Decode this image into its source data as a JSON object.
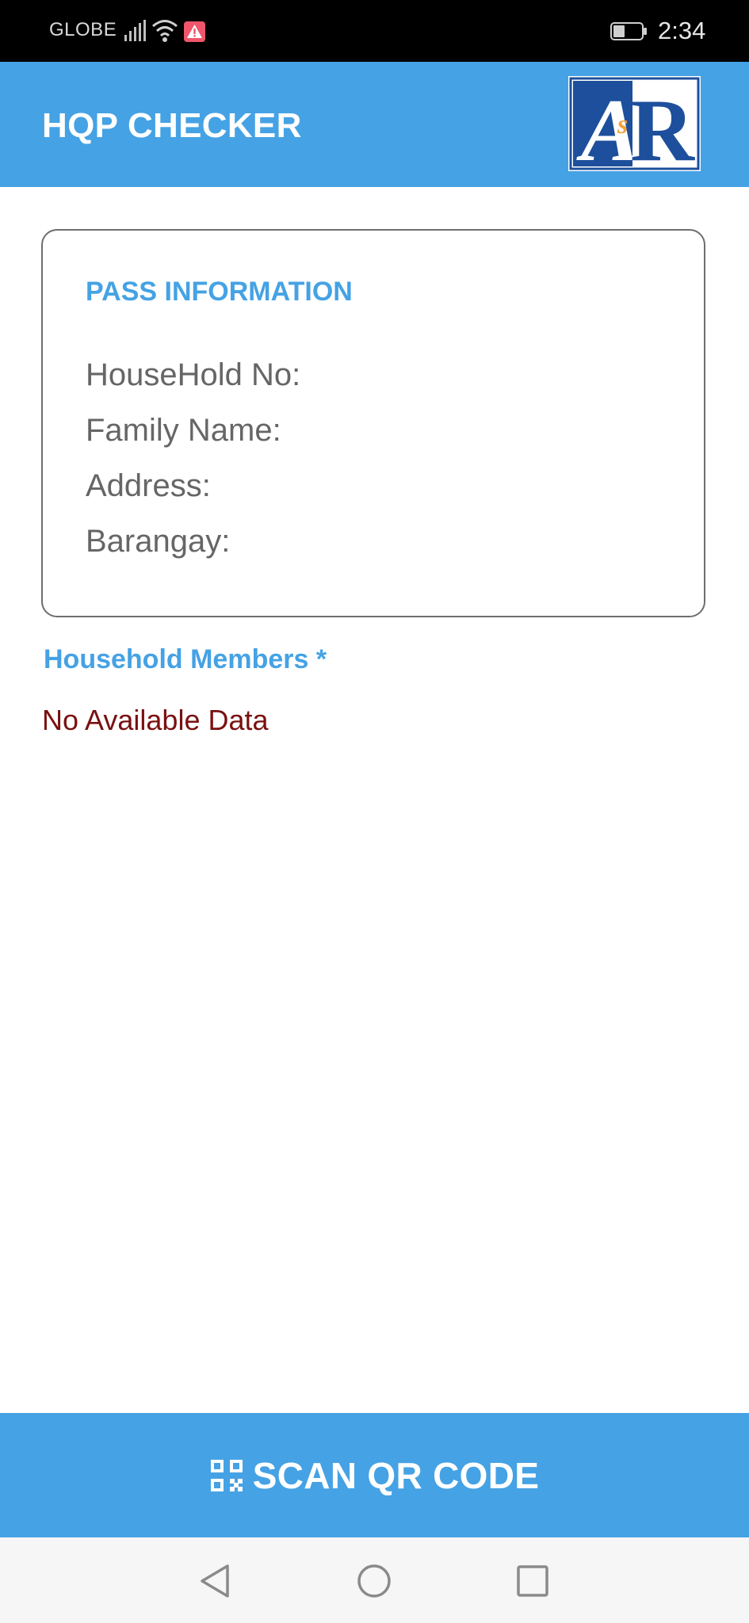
{
  "status_bar": {
    "carrier": "GLOBE",
    "time": "2:34",
    "icons": [
      "signal-icon",
      "wifi-icon",
      "alert-icon",
      "battery-icon"
    ]
  },
  "app_bar": {
    "title": "HQP CHECKER",
    "logo_text": "ASR"
  },
  "pass_card": {
    "heading": "PASS INFORMATION",
    "fields": {
      "household_no": "HouseHold No:",
      "family_name": "Family Name:",
      "address": "Address:",
      "barangay": "Barangay:"
    }
  },
  "members": {
    "heading": "Household Members *",
    "empty_text": "No Available Data"
  },
  "scan_button": {
    "label": "SCAN QR CODE",
    "icon": "qr-code-icon"
  },
  "nav_bar": {
    "icons": [
      "back-icon",
      "home-icon",
      "recent-apps-icon"
    ]
  },
  "colors": {
    "accent": "#45a2e4",
    "empty_text": "#7a1010",
    "label_gray": "#666666"
  }
}
